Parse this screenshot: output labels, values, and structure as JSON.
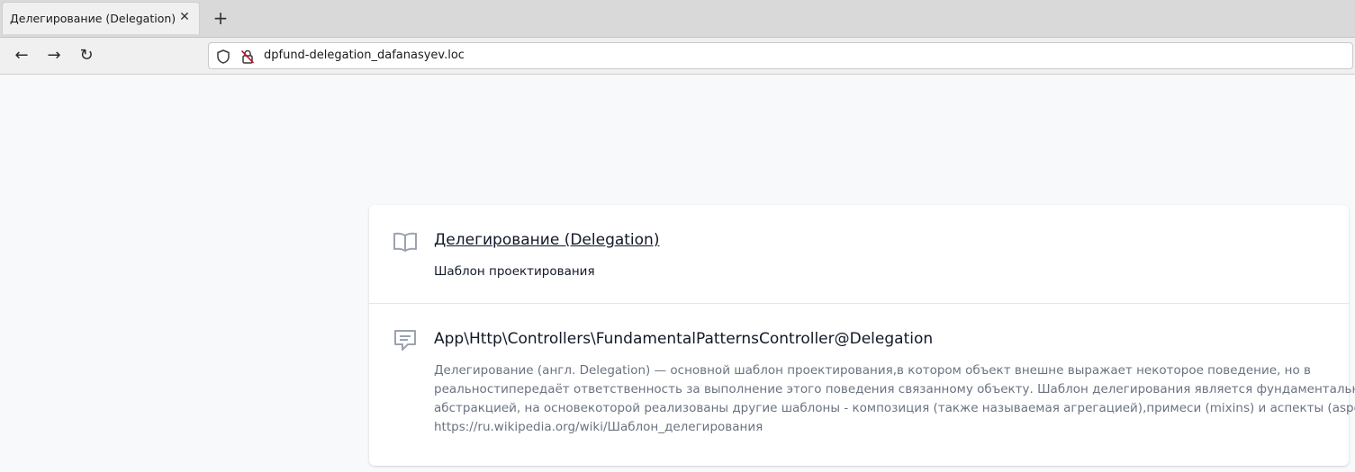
{
  "browser": {
    "tab": {
      "title": "Делегирование (Delegation)",
      "close_glyph": "✕"
    },
    "new_tab_glyph": "+",
    "nav": {
      "back_glyph": "←",
      "forward_glyph": "→",
      "reload_glyph": "↻"
    },
    "address": "dpfund-delegation_dafanasyev.loc",
    "icons": [
      "shield-icon",
      "insecure-lock-icon"
    ]
  },
  "card": {
    "header": {
      "icon": "book-icon",
      "title": "Делегирование (Delegation)",
      "subtitle": "Шаблон проектирования"
    },
    "details": {
      "icon": "chat-icon",
      "title": "App\\Http\\Controllers\\FundamentalPatternsController@Delegation",
      "lines": [
        "Делегирование (англ. Delegation) — основной шаблон проектирования,в котором объект внешне выражает некоторое поведение, но в",
        "реальностипередаёт ответственность за выполнение этого поведения связанному объекту. Шаблон делегирования является фундаментальной",
        "абстракцией, на основекоторой реализованы другие шаблоны - композиция (также называемая агрегацией),примеси (mixins) и аспекты (aspects).",
        "https://ru.wikipedia.org/wiki/Шаблон_делегирования"
      ]
    }
  },
  "colors": {
    "page_background": "#f7f9fb",
    "card_background": "#ffffff",
    "icon_gray": "#9ca3af",
    "description_text": "#6b7280"
  }
}
